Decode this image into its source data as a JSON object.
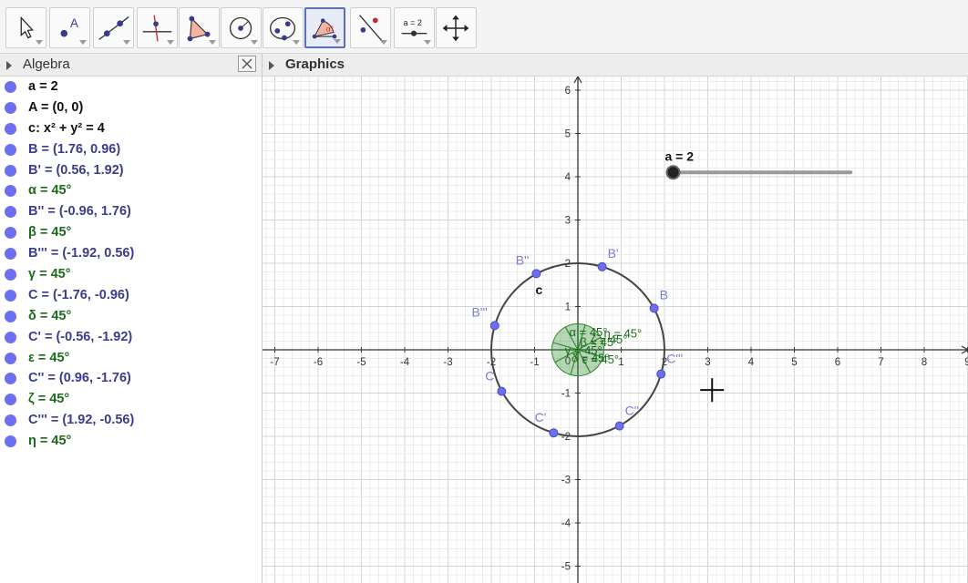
{
  "app": {
    "toolbar": {
      "tools": [
        {
          "name": "move-tool",
          "icon": "pointer-icon",
          "active": false
        },
        {
          "name": "point-tool",
          "icon": "point-A-icon",
          "active": false
        },
        {
          "name": "line-tool",
          "icon": "line-icon",
          "active": false
        },
        {
          "name": "perpendicular-tool",
          "icon": "perpendicular-line-icon",
          "active": false
        },
        {
          "name": "polygon-tool",
          "icon": "polygon-icon",
          "active": false
        },
        {
          "name": "circle-tool",
          "icon": "circle-center-point-icon",
          "active": false
        },
        {
          "name": "conic-tool",
          "icon": "ellipse-icon",
          "active": false
        },
        {
          "name": "angle-tool",
          "icon": "angle-icon",
          "active": true,
          "label": "α°"
        },
        {
          "name": "reflect-tool",
          "icon": "reflect-about-line-icon",
          "active": false
        },
        {
          "name": "slider-tool",
          "icon": "slider-icon",
          "active": false,
          "label": "a = 2"
        },
        {
          "name": "move-graphics-tool",
          "icon": "move-graphics-view-icon",
          "active": false
        }
      ]
    },
    "algebra": {
      "title": "Algebra",
      "items": [
        {
          "text": "a = 2",
          "color": "black"
        },
        {
          "text": "A = (0, 0)",
          "color": "black"
        },
        {
          "text": "c: x² + y² = 4",
          "color": "black"
        },
        {
          "text": "B = (1.76, 0.96)",
          "color": "blue"
        },
        {
          "text": "B' = (0.56, 1.92)",
          "color": "blue"
        },
        {
          "text": "α = 45°",
          "color": "green"
        },
        {
          "text": "B'' = (-0.96, 1.76)",
          "color": "blue"
        },
        {
          "text": "β = 45°",
          "color": "green"
        },
        {
          "text": "B''' = (-1.92, 0.56)",
          "color": "blue"
        },
        {
          "text": "γ = 45°",
          "color": "green"
        },
        {
          "text": "C = (-1.76, -0.96)",
          "color": "blue"
        },
        {
          "text": "δ = 45°",
          "color": "green"
        },
        {
          "text": "C' = (-0.56, -1.92)",
          "color": "blue"
        },
        {
          "text": "ε = 45°",
          "color": "green"
        },
        {
          "text": "C'' = (0.96, -1.76)",
          "color": "blue"
        },
        {
          "text": "ζ = 45°",
          "color": "green"
        },
        {
          "text": "C''' = (1.92, -0.56)",
          "color": "blue"
        },
        {
          "text": "η = 45°",
          "color": "green"
        }
      ]
    },
    "graphics": {
      "title": "Graphics",
      "x_ticks": [
        "-7",
        "-6",
        "-5",
        "-4",
        "-3",
        "-2",
        "-1",
        "1",
        "2",
        "3",
        "4",
        "5",
        "6",
        "7",
        "8",
        "9"
      ],
      "y_ticks": [
        "6",
        "5",
        "4",
        "3",
        "2",
        "1",
        "-1",
        "-2",
        "-3",
        "-4",
        "-5"
      ],
      "origin_label": "0",
      "slider_label": "a = 2",
      "circle_label": "c",
      "angle_text": "45°",
      "angle_labels": [
        "α",
        "β",
        "γ",
        "δ",
        "ε",
        "ζ",
        "η"
      ],
      "points": [
        {
          "label": "B",
          "x": 1.76,
          "y": 0.96
        },
        {
          "label": "B'",
          "x": 0.56,
          "y": 1.92
        },
        {
          "label": "B''",
          "x": -0.96,
          "y": 1.76
        },
        {
          "label": "B'''",
          "x": -1.92,
          "y": 0.56
        },
        {
          "label": "C",
          "x": -1.76,
          "y": -0.96
        },
        {
          "label": "C'",
          "x": -0.56,
          "y": -1.92
        },
        {
          "label": "C''",
          "x": 0.96,
          "y": -1.76
        },
        {
          "label": "C'''",
          "x": 1.92,
          "y": -0.56
        }
      ],
      "circle": {
        "cx": 0,
        "cy": 0,
        "r": 2
      },
      "slider": {
        "value": 2,
        "min": 0,
        "max": 4
      }
    },
    "colors": {
      "point": "#6b6ff0",
      "angle_fill": "#2e8b2e",
      "angle_text": "#1c6b1c",
      "circle": "#444444",
      "grid_minor": "#ececec",
      "grid_major": "#d4d4d4"
    }
  }
}
